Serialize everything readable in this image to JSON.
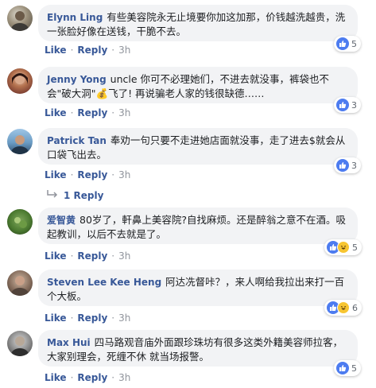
{
  "actions": {
    "like": "Like",
    "reply": "Reply",
    "dot": "·"
  },
  "comments": [
    {
      "name": "Elynn Ling",
      "text": "有些美容院永无止境要你加这加那，价钱越洗越贵，洗一张脸好像在送钱，干脆不去。",
      "time": "3h",
      "reactions": "5",
      "reaction_types": [
        "like"
      ]
    },
    {
      "name": "Jenny Yong",
      "text": "uncle  你可不必理她们，不进去就没事，裤袋也不会\"破大洞\"💰飞了! 再说骗老人家的钱很缺德……",
      "time": "3h",
      "reactions": "3",
      "reaction_types": [
        "like"
      ]
    },
    {
      "name": "Patrick Tan",
      "text": "奉劝一句只要不走进她店面就没事，走了进去$就会从口袋飞出去。",
      "time": "3h",
      "reactions": "3",
      "reaction_types": [
        "like"
      ]
    },
    {
      "name": "爱智黄",
      "text": "80岁了，軒鼻上美容院?自找麻烦。还是醉翁之意不在酒。吸起教训，以后不去就是了。",
      "time": "3h",
      "reactions": "5",
      "reaction_types": [
        "like",
        "haha"
      ]
    },
    {
      "name": "Steven Lee Kee Heng",
      "text": "阿达冼督咔？，来人啊给我拉出来打一百个大板。",
      "time": "3h",
      "reactions": "6",
      "reaction_types": [
        "like",
        "haha"
      ]
    },
    {
      "name": "Max Hui",
      "text": "四马路观音庙外面跟珍珠坊有很多这类外籍美容师拉客，大家别理会，死缠不休 就当场报警。",
      "time": "3h",
      "reactions": "5",
      "reaction_types": [
        "like"
      ]
    }
  ],
  "reply_link": "1 Reply",
  "colors": {
    "link": "#385898",
    "bubble": "#f2f3f5",
    "like": "#4d7cf0",
    "haha": "#f7c531"
  },
  "icons": {
    "like": "thumbs-up-icon",
    "haha": "laughing-face-icon",
    "reply": "reply-arrow-icon"
  }
}
